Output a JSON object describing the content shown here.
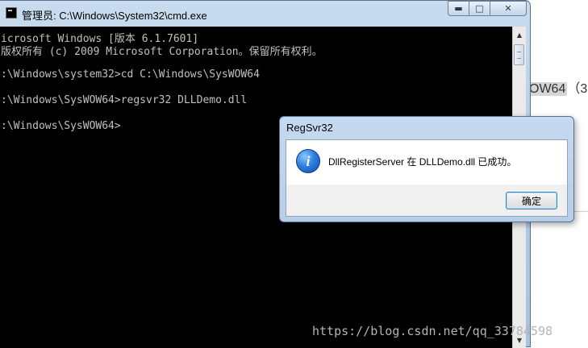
{
  "background": {
    "snippet_highlight": "OW64",
    "snippet_rest": "（3"
  },
  "cmd_window": {
    "title": "管理员: C:\\Windows\\System32\\cmd.exe",
    "console_lines": [
      "icrosoft Windows [版本 6.1.7601]",
      "版权所有 (c) 2009 Microsoft Corporation。保留所有权利。",
      "",
      ":\\Windows\\system32>cd C:\\Windows\\SysWOW64",
      "",
      ":\\Windows\\SysWOW64>regsvr32 DLLDemo.dll",
      "",
      ":\\Windows\\SysWOW64>"
    ]
  },
  "dialog": {
    "title": "RegSvr32",
    "message": "DllRegisterServer 在 DLLDemo.dll 已成功。",
    "ok_label": "确定"
  },
  "watermark": "https://blog.csdn.net/qq_33784598"
}
